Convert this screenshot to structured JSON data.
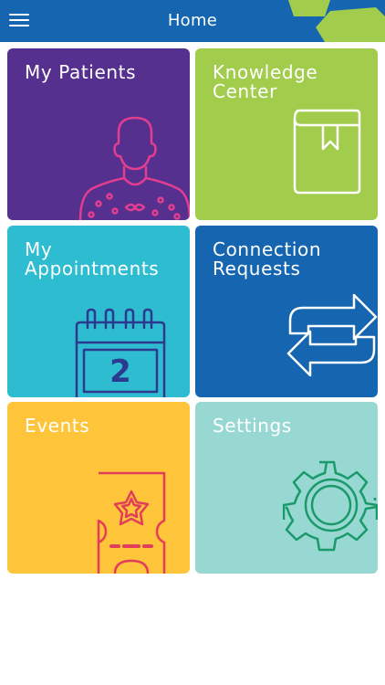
{
  "header": {
    "title": "Home",
    "background": "#1565b0",
    "accent": "#a2cc4c"
  },
  "tiles": [
    {
      "label": "My Patients",
      "color": "#55308f",
      "icon": "patient-icon",
      "icon_color": "#e23d8f"
    },
    {
      "label": "Knowledge\nCenter",
      "color": "#a2cc4c",
      "icon": "book-icon",
      "icon_color": "#ffffff"
    },
    {
      "label": "My\nAppointments",
      "color": "#2ebdd0",
      "icon": "calendar-icon",
      "icon_color": "#2b3a8f"
    },
    {
      "label": "Connection\nRequests",
      "color": "#1565b0",
      "icon": "arrows-exchange-icon",
      "icon_color": "#ffffff"
    },
    {
      "label": "Events",
      "color": "#fec43a",
      "icon": "ticket-icon",
      "icon_color": "#e23d5a"
    },
    {
      "label": "Settings",
      "color": "#98d8d2",
      "icon": "gear-icon",
      "icon_color": "#1a9a6a"
    }
  ],
  "calendar_day": "2"
}
